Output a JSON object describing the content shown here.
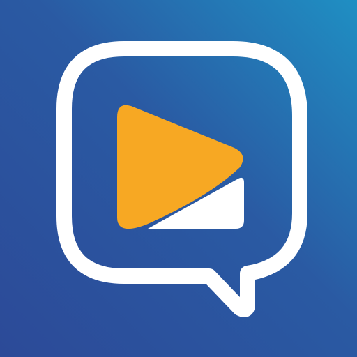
{
  "icon": {
    "name": "chat-video-app-icon",
    "colors": {
      "background_start": "#2c4a98",
      "background_mid": "#2a5aa3",
      "background_end": "#1f8fc3",
      "bubble_outline": "#ffffff",
      "play_triangle": "#f7a823",
      "screen_base": "#ffffff"
    }
  }
}
